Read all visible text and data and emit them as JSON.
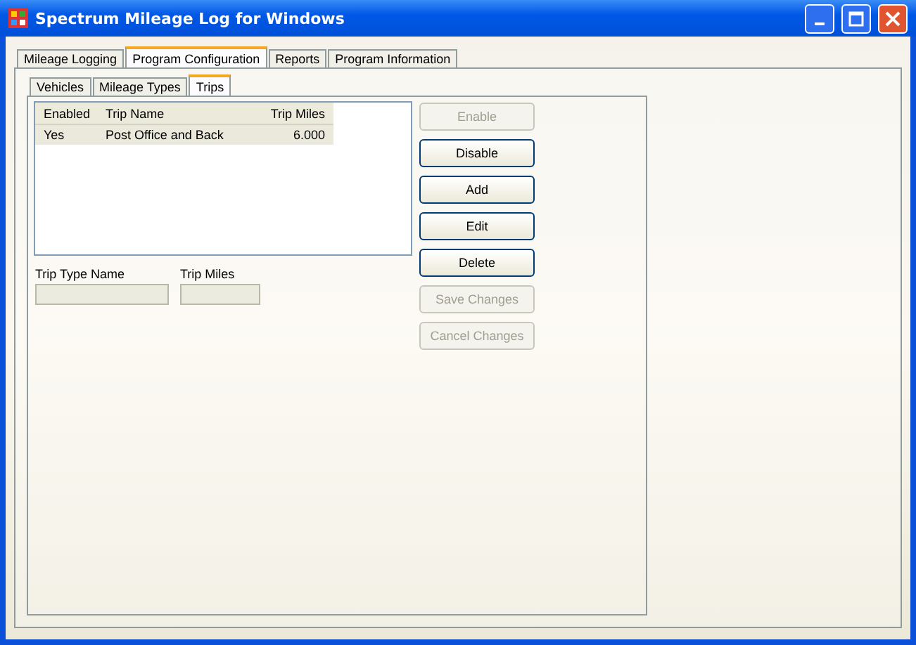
{
  "window": {
    "title": "Spectrum Mileage Log for Windows"
  },
  "tabs": [
    {
      "label": "Mileage Logging",
      "selected": false
    },
    {
      "label": "Program Configuration",
      "selected": true
    },
    {
      "label": "Reports",
      "selected": false
    },
    {
      "label": "Program Information",
      "selected": false
    }
  ],
  "subtabs": [
    {
      "label": "Vehicles",
      "selected": false
    },
    {
      "label": "Mileage Types",
      "selected": false
    },
    {
      "label": "Trips",
      "selected": true
    }
  ],
  "table": {
    "columns": [
      "Enabled",
      "Trip Name",
      "Trip Miles"
    ],
    "rows": [
      {
        "cells": [
          "Yes",
          "Post Office and Back",
          "6.000"
        ],
        "selected": true
      }
    ]
  },
  "fields": [
    {
      "label": "Trip Type Name",
      "disabled": true
    },
    {
      "label": "Trip Miles",
      "disabled": true
    }
  ],
  "buttons": [
    {
      "label": "Enable",
      "disabled": true
    },
    {
      "label": "Disable",
      "disabled": false
    },
    {
      "label": "Add",
      "disabled": false
    },
    {
      "label": "Edit",
      "disabled": false
    },
    {
      "label": "Delete",
      "disabled": false
    },
    {
      "label": "Save Changes",
      "disabled": true
    },
    {
      "label": "Cancel Changes",
      "disabled": true
    }
  ]
}
